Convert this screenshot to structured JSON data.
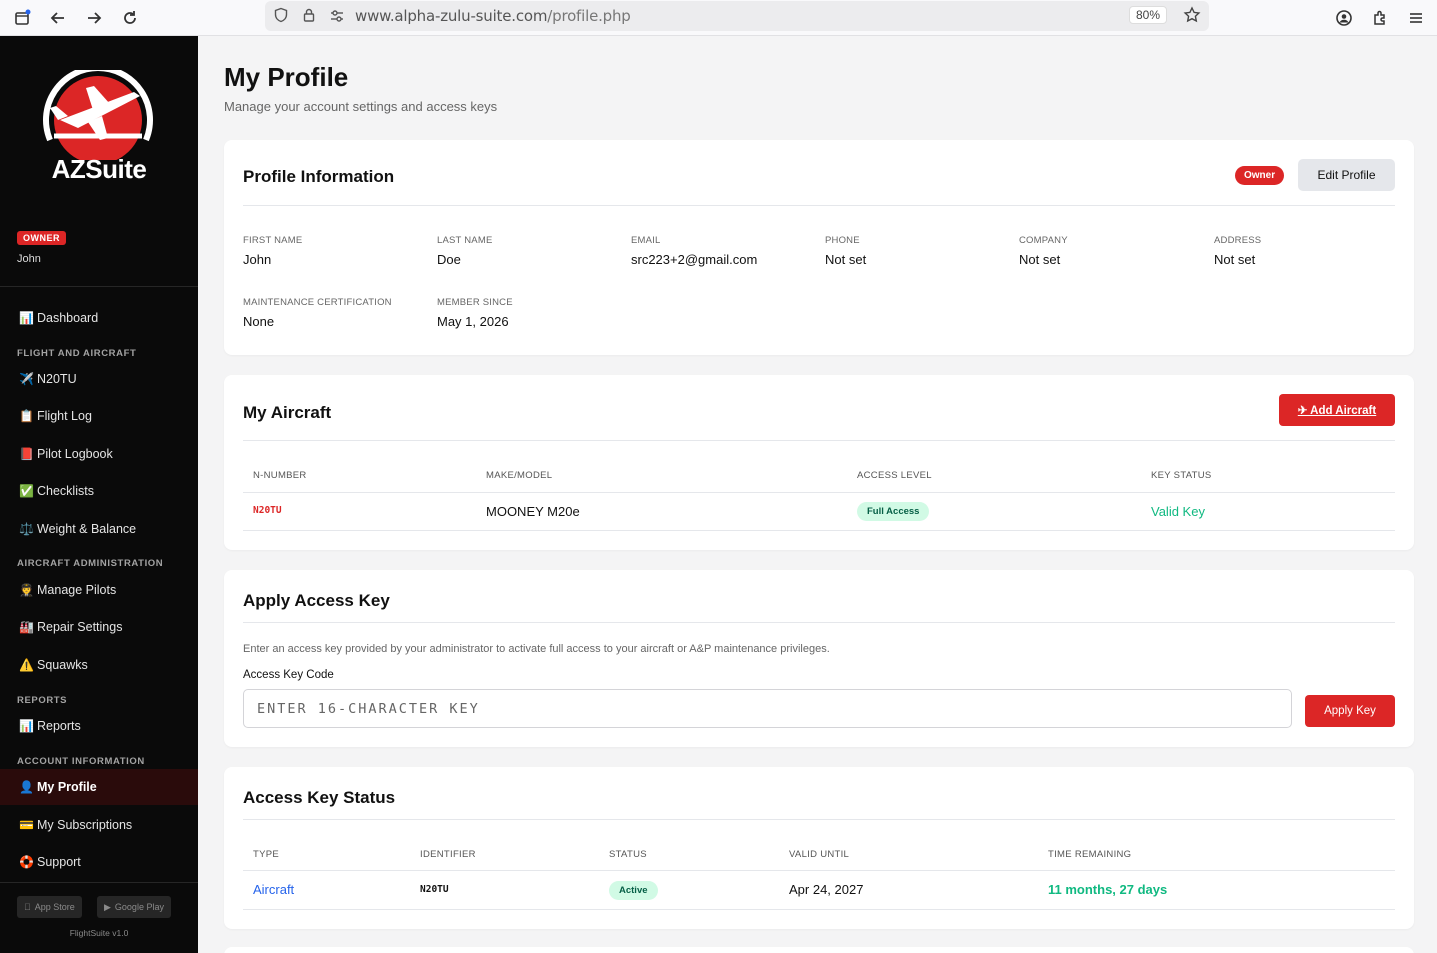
{
  "browser": {
    "url_host": "www.alpha-zulu-suite.com",
    "url_path": "/profile.php",
    "zoom": "80%"
  },
  "sidebar": {
    "logo_text": "AZSuite",
    "role": "OWNER",
    "user": "John",
    "sections": {
      "flight": "FLIGHT AND AIRCRAFT",
      "admin": "AIRCRAFT ADMINISTRATION",
      "reports": "REPORTS",
      "account": "ACCOUNT INFORMATION"
    },
    "items": [
      {
        "icon": "📊",
        "label": "Dashboard"
      },
      {
        "icon": "✈️",
        "label": "N20TU"
      },
      {
        "icon": "📋",
        "label": "Flight Log"
      },
      {
        "icon": "📕",
        "label": "Pilot Logbook"
      },
      {
        "icon": "✅",
        "label": "Checklists"
      },
      {
        "icon": "⚖️",
        "label": "Weight & Balance"
      },
      {
        "icon": "🧑‍✈️",
        "label": "Manage Pilots"
      },
      {
        "icon": "🏭",
        "label": "Repair Settings"
      },
      {
        "icon": "⚠️",
        "label": "Squawks"
      },
      {
        "icon": "📊",
        "label": "Reports"
      },
      {
        "icon": "👤",
        "label": "My Profile"
      },
      {
        "icon": "💳",
        "label": "My Subscriptions"
      },
      {
        "icon": "🛟",
        "label": "Support"
      }
    ],
    "app_store": "App Store",
    "google_play": "Google Play",
    "version": "FlightSuite v1.0"
  },
  "page": {
    "title": "My Profile",
    "subtitle": "Manage your account settings and access keys"
  },
  "profile": {
    "title": "Profile Information",
    "badge": "Owner",
    "edit_label": "Edit Profile",
    "fields": [
      {
        "label": "FIRST NAME",
        "value": "John"
      },
      {
        "label": "LAST NAME",
        "value": "Doe"
      },
      {
        "label": "EMAIL",
        "value": "src223+2@gmail.com"
      },
      {
        "label": "PHONE",
        "value": "Not set"
      },
      {
        "label": "COMPANY",
        "value": "Not set"
      },
      {
        "label": "ADDRESS",
        "value": "Not set"
      },
      {
        "label": "MAINTENANCE CERTIFICATION",
        "value": "None"
      },
      {
        "label": "MEMBER SINCE",
        "value": "May 1, 2026"
      }
    ]
  },
  "aircraft": {
    "title": "My Aircraft",
    "add_label": "✈ Add Aircraft",
    "headers": [
      "N-NUMBER",
      "MAKE/MODEL",
      "ACCESS LEVEL",
      "KEY STATUS"
    ],
    "rows": [
      {
        "n_number": "N20TU",
        "make_model": "MOONEY M20e",
        "access": "Full Access",
        "key_status": "Valid Key"
      }
    ]
  },
  "apply_key": {
    "title": "Apply Access Key",
    "description": "Enter an access key provided by your administrator to activate full access to your aircraft or A&P maintenance privileges.",
    "input_label": "Access Key Code",
    "placeholder": "ENTER 16-CHARACTER KEY",
    "button": "Apply Key"
  },
  "key_status": {
    "title": "Access Key Status",
    "headers": [
      "TYPE",
      "IDENTIFIER",
      "STATUS",
      "VALID UNTIL",
      "TIME REMAINING"
    ],
    "rows": [
      {
        "type": "Aircraft",
        "identifier": "N20TU",
        "status": "Active",
        "valid_until": "Apr 24, 2027",
        "remaining": "11 months, 27 days"
      }
    ]
  },
  "colors": {
    "accent": "#dc2626",
    "link": "#2563eb",
    "success": "#10b981"
  }
}
